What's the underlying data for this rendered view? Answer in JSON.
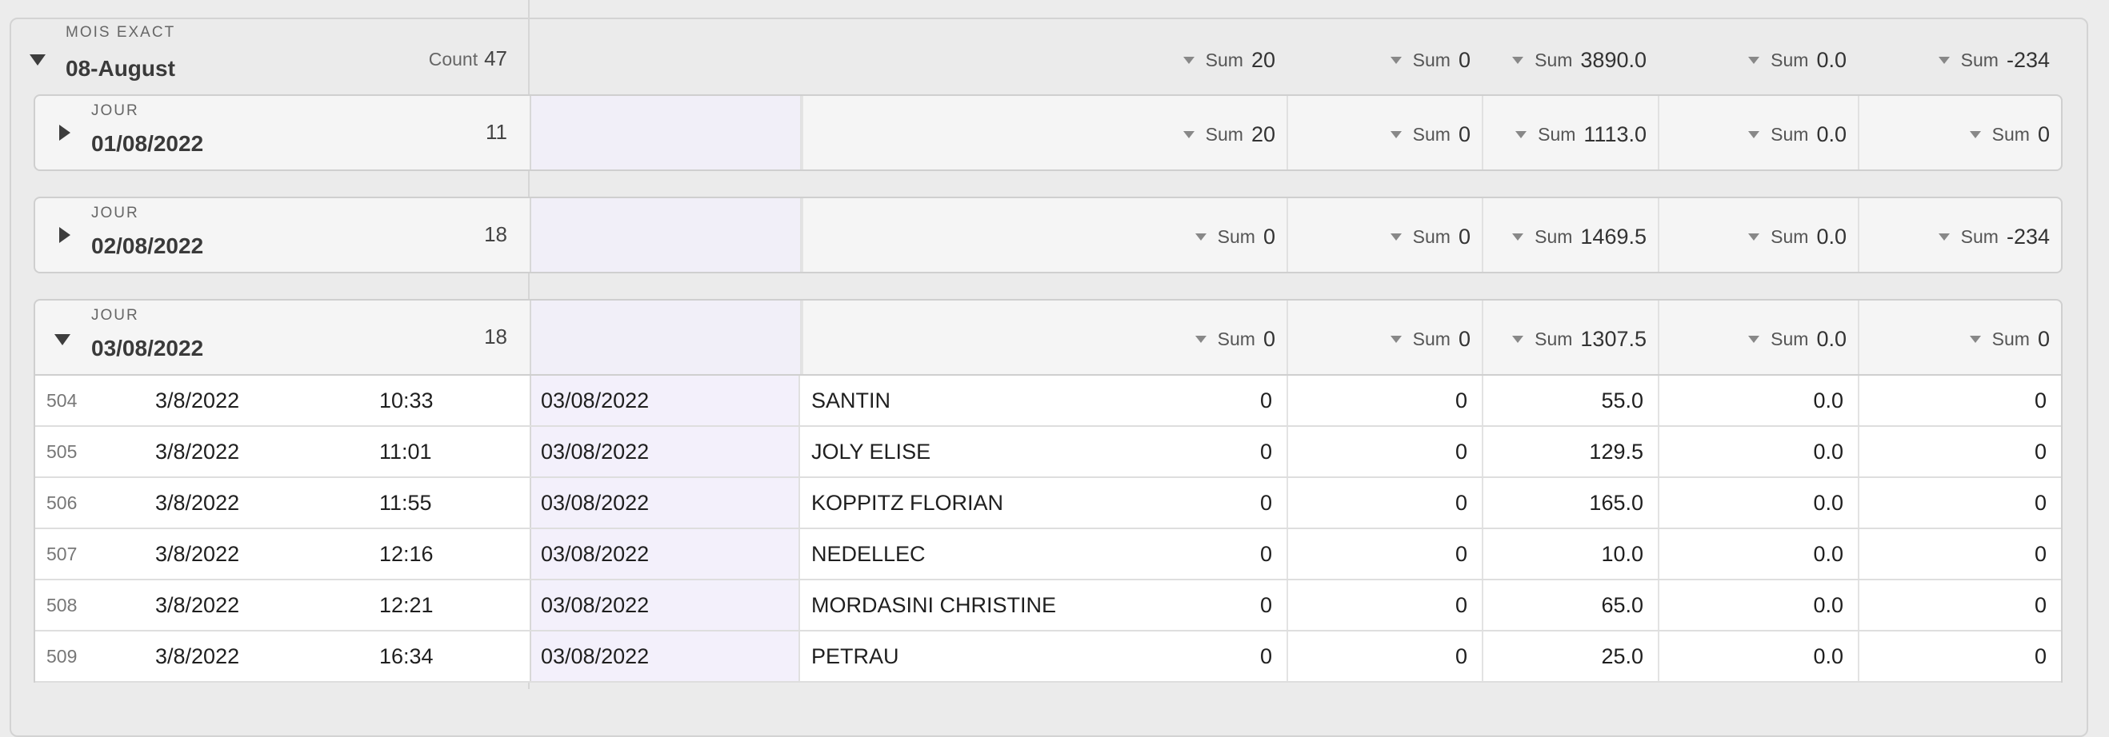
{
  "group": {
    "label": "MOIS EXACT",
    "value": "08-August",
    "count_label": "Count",
    "count": "47",
    "sums": [
      {
        "label": "Sum",
        "value": "20"
      },
      {
        "label": "Sum",
        "value": "0"
      },
      {
        "label": "Sum",
        "value": "3890.0"
      },
      {
        "label": "Sum",
        "value": "0.0"
      },
      {
        "label": "Sum",
        "value": "-234"
      }
    ]
  },
  "subgroups": [
    {
      "label": "JOUR",
      "value": "01/08/2022",
      "count": "11",
      "expanded": false,
      "sums": [
        {
          "label": "Sum",
          "value": "20"
        },
        {
          "label": "Sum",
          "value": "0"
        },
        {
          "label": "Sum",
          "value": "1113.0"
        },
        {
          "label": "Sum",
          "value": "0.0"
        },
        {
          "label": "Sum",
          "value": "0"
        }
      ]
    },
    {
      "label": "JOUR",
      "value": "02/08/2022",
      "count": "18",
      "expanded": false,
      "sums": [
        {
          "label": "Sum",
          "value": "0"
        },
        {
          "label": "Sum",
          "value": "0"
        },
        {
          "label": "Sum",
          "value": "1469.5"
        },
        {
          "label": "Sum",
          "value": "0.0"
        },
        {
          "label": "Sum",
          "value": "-234"
        }
      ]
    },
    {
      "label": "JOUR",
      "value": "03/08/2022",
      "count": "18",
      "expanded": true,
      "sums": [
        {
          "label": "Sum",
          "value": "0"
        },
        {
          "label": "Sum",
          "value": "0"
        },
        {
          "label": "Sum",
          "value": "1307.5"
        },
        {
          "label": "Sum",
          "value": "0.0"
        },
        {
          "label": "Sum",
          "value": "0"
        }
      ]
    }
  ],
  "rows": [
    {
      "num": "504",
      "date": "3/8/2022",
      "time": "10:33",
      "day": "03/08/2022",
      "client": "SANTIN",
      "v1": "0",
      "v2": "0",
      "v3": "55.0",
      "v4": "0.0",
      "v5": "0"
    },
    {
      "num": "505",
      "date": "3/8/2022",
      "time": "11:01",
      "day": "03/08/2022",
      "client": "JOLY ELISE",
      "v1": "0",
      "v2": "0",
      "v3": "129.5",
      "v4": "0.0",
      "v5": "0"
    },
    {
      "num": "506",
      "date": "3/8/2022",
      "time": "11:55",
      "day": "03/08/2022",
      "client": "KOPPITZ FLORIAN",
      "v1": "0",
      "v2": "0",
      "v3": "165.0",
      "v4": "0.0",
      "v5": "0"
    },
    {
      "num": "507",
      "date": "3/8/2022",
      "time": "12:16",
      "day": "03/08/2022",
      "client": "NEDELLEC",
      "v1": "0",
      "v2": "0",
      "v3": "10.0",
      "v4": "0.0",
      "v5": "0"
    },
    {
      "num": "508",
      "date": "3/8/2022",
      "time": "12:21",
      "day": "03/08/2022",
      "client": "MORDASINI CHRISTINE",
      "v1": "0",
      "v2": "0",
      "v3": "65.0",
      "v4": "0.0",
      "v5": "0"
    },
    {
      "num": "509",
      "date": "3/8/2022",
      "time": "16:34",
      "day": "03/08/2022",
      "client": "PETRAU",
      "v1": "0",
      "v2": "0",
      "v3": "25.0",
      "v4": "0.0",
      "v5": "0"
    }
  ]
}
